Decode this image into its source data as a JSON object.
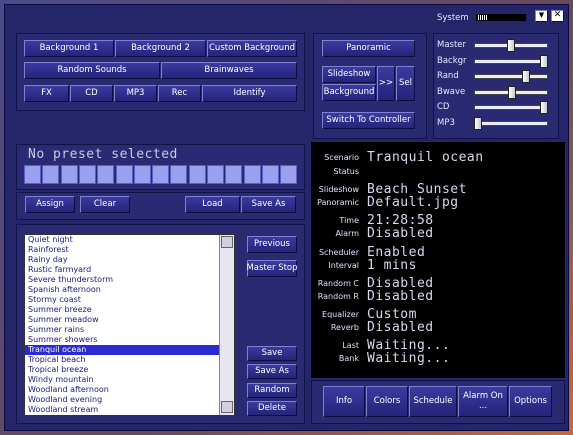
{
  "system_bar": {
    "label": "System",
    "minimize_icon": "triangle-down-icon",
    "close_icon": "close-x-icon"
  },
  "top_left": {
    "row1": [
      "Background 1",
      "Background 2",
      "Custom Background"
    ],
    "row2": [
      "Random Sounds",
      "Brainwaves"
    ],
    "row3": [
      "FX",
      "CD",
      "MP3",
      "Rec",
      "Identify"
    ]
  },
  "top_mid": {
    "panoramic": "Panoramic",
    "slideshow": "Slideshow",
    "background": "Background",
    "next": ">>",
    "sel": "Sel",
    "switch": "Switch To Controller"
  },
  "volume": {
    "labels": [
      "Master",
      "Backgr",
      "Rand",
      "Bwave",
      "CD",
      "MP3"
    ],
    "levels": [
      0.5,
      1.0,
      0.72,
      0.52,
      1.0,
      0.0
    ]
  },
  "preset": {
    "text": "No preset selected",
    "cells": 15
  },
  "preset_buttons": {
    "assign": "Assign",
    "clear": "Clear",
    "load": "Load",
    "save_as": "Save As"
  },
  "list": {
    "items": [
      "Quiet night",
      "Rainforest",
      "Rainy day",
      "Rustic farmyard",
      "Severe thunderstorm",
      "Spanish afternoon",
      "Stormy coast",
      "Summer breeze",
      "Summer meadow",
      "Summer rains",
      "Summer showers",
      "Tranquil ocean",
      "Tropical beach",
      "Tropical breeze",
      "Windy mountain",
      "Woodland afternoon",
      "Woodland evening",
      "Woodland stream"
    ],
    "selected_index": 11
  },
  "list_buttons": {
    "previous": "Previous",
    "master_stop": "Master Stop",
    "save": "Save",
    "save_as": "Save As",
    "random": "Random",
    "delete": "Delete"
  },
  "status": {
    "scenario": {
      "label": "Scenario",
      "value": "Tranquil ocean"
    },
    "status": {
      "label": "Status",
      "value": ""
    },
    "slideshow": {
      "label": "Slideshow",
      "value": "Beach Sunset"
    },
    "panoramic": {
      "label": "Panoramic",
      "value": "Default.jpg"
    },
    "time": {
      "label": "Time",
      "value": "21:28:58"
    },
    "alarm": {
      "label": "Alarm",
      "value": "Disabled"
    },
    "scheduler": {
      "label": "Scheduler",
      "value": "Enabled"
    },
    "interval": {
      "label": "Interval",
      "value": "1 mins"
    },
    "random_c": {
      "label": "Random C",
      "value": "Disabled"
    },
    "random_r": {
      "label": "Random R",
      "value": "Disabled"
    },
    "equalizer": {
      "label": "Equalizer",
      "value": "Custom"
    },
    "reverb": {
      "label": "Reverb",
      "value": "Disabled"
    },
    "last": {
      "label": "Last",
      "value": "Waiting..."
    },
    "bank": {
      "label": "Bank",
      "value": "Waiting..."
    }
  },
  "bottom_buttons": {
    "info": "Info",
    "colors": "Colors",
    "schedule": "Schedule",
    "alarm_on": "Alarm On",
    "alarm_more": "...",
    "options": "Options"
  }
}
